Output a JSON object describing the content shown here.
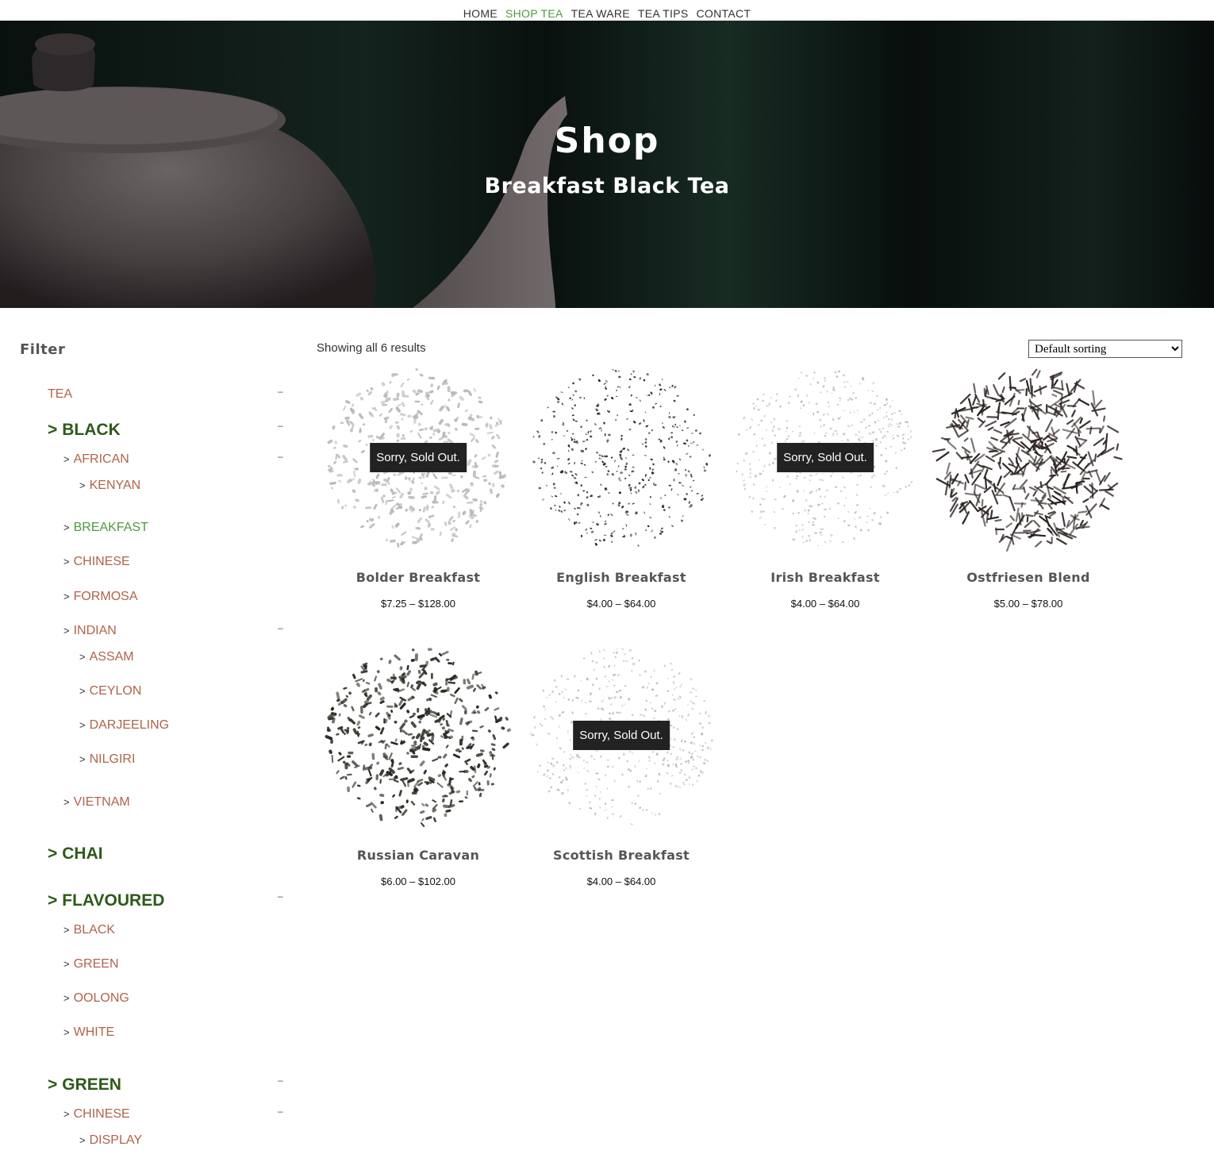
{
  "nav": {
    "items": [
      {
        "label": "HOME"
      },
      {
        "label": "SHOP TEA"
      },
      {
        "label": "TEA WARE"
      },
      {
        "label": "TEA TIPS"
      },
      {
        "label": "CONTACT"
      }
    ],
    "active": "SHOP TEA"
  },
  "hero": {
    "title": "Shop",
    "subtitle": "Breakfast Black Tea"
  },
  "sidebar": {
    "title": "Filter",
    "arrow": ">",
    "toggle": "–",
    "categories": {
      "tea": "TEA",
      "black": "BLACK",
      "african": "AFRICAN",
      "kenyan": "KENYAN",
      "breakfast": "BREAKFAST",
      "chinese": "CHINESE",
      "formosa": "FORMOSA",
      "indian": "INDIAN",
      "assam": "ASSAM",
      "ceylon": "CEYLON",
      "darjeeling": "DARJEELING",
      "nilgiri": "NILGIRI",
      "vietnam": "VIETNAM",
      "chai": "CHAI",
      "flavoured": "FLAVOURED",
      "fl_black": "BLACK",
      "fl_green": "GREEN",
      "fl_oolong": "OOLONG",
      "fl_white": "WHITE",
      "green": "GREEN",
      "gr_chinese": "CHINESE",
      "gr_display": "DISPLAY"
    }
  },
  "shop": {
    "result_count": "Showing all 6 results",
    "sorting": {
      "selected": "Default sorting"
    },
    "sold_out_label": "Sorry, Sold Out.",
    "products": [
      {
        "name": "Bolder Breakfast",
        "price": "$7.25 – $128.00",
        "sold_out": true
      },
      {
        "name": "English Breakfast",
        "price": "$4.00 – $64.00",
        "sold_out": false
      },
      {
        "name": "Irish Breakfast",
        "price": "$4.00 – $64.00",
        "sold_out": true
      },
      {
        "name": "Ostfriesen Blend",
        "price": "$5.00 – $78.00",
        "sold_out": false
      },
      {
        "name": "Russian Caravan",
        "price": "$6.00 – $102.00",
        "sold_out": false
      },
      {
        "name": "Scottish Breakfast",
        "price": "$4.00 – $64.00",
        "sold_out": true
      }
    ]
  },
  "colors": {
    "nav_active": "#4c9a3a",
    "category_link": "#b0634a",
    "category_parent": "#2d5a1a",
    "badge_bg": "#222222"
  }
}
